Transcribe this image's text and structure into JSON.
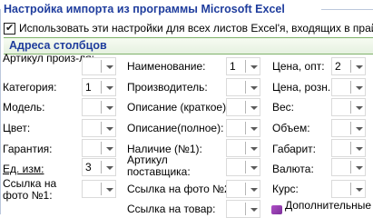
{
  "group": {
    "title": "Настройка импорта из программы Microsoft Excel",
    "apply_all": {
      "label": "Использовать эти настройки для всех листов Excel'я, входящих в прайс",
      "checked": true
    }
  },
  "section": {
    "title": "Адреса столбцов"
  },
  "fields": {
    "article": {
      "label": "Артикул произ-ля:",
      "value": ""
    },
    "category": {
      "label": "Категория:",
      "value": "1"
    },
    "model": {
      "label": "Модель:",
      "value": ""
    },
    "color": {
      "label": "Цвет:",
      "value": ""
    },
    "warranty": {
      "label": "Гарантия:",
      "value": ""
    },
    "unit": {
      "label": "Ед. изм:",
      "value": "3"
    },
    "photo1": {
      "label": "Ссылка на фото №1:",
      "value": ""
    },
    "name": {
      "label": "Наименование:",
      "value": "1"
    },
    "manufacturer": {
      "label": "Производитель:",
      "value": ""
    },
    "desc_short": {
      "label": "Описание (краткое):",
      "value": ""
    },
    "desc_full": {
      "label": "Описание(полное):",
      "value": ""
    },
    "stock": {
      "label": "Наличие (№1):",
      "value": ""
    },
    "supplier_article": {
      "label": "Артикул поставщика:",
      "value": ""
    },
    "photo2": {
      "label": "Ссылка на фото №2:",
      "value": ""
    },
    "product_link": {
      "label": "Ссылка на товар:",
      "value": ""
    },
    "price_wholesale": {
      "label": "Цена, опт:",
      "value": "2"
    },
    "price_retail": {
      "label": "Цена, розн.:",
      "value": ""
    },
    "weight": {
      "label": "Вес:",
      "value": ""
    },
    "volume": {
      "label": "Объем:",
      "value": ""
    },
    "dimensions": {
      "label": "Габарит:",
      "value": ""
    },
    "currency": {
      "label": "Валюта:",
      "value": ""
    },
    "rate": {
      "label": "Курс:",
      "value": ""
    },
    "additional": {
      "label": "Дополнительные"
    }
  },
  "icons": {
    "additional": "extra-fields-icon"
  },
  "colors": {
    "title_blue": "#1f3d9d",
    "section_green": "#7fb26a"
  }
}
